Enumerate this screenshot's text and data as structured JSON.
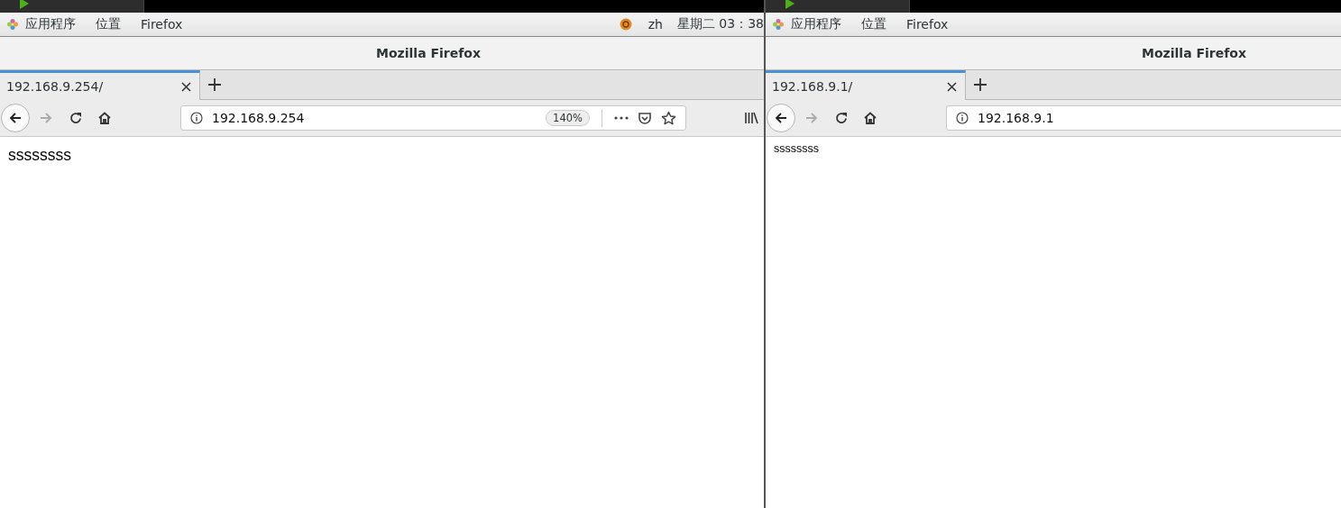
{
  "screens": [
    {
      "top_bar": {
        "menus": [
          "应用程序",
          "位置",
          "Firefox"
        ],
        "tray": {
          "language": "zh",
          "clock": "星期二 03：38"
        }
      },
      "window_title": "Mozilla Firefox",
      "tabs": [
        {
          "label": "192.168.9.254/",
          "selected": true
        }
      ],
      "address": {
        "value": "192.168.9.254",
        "zoom": "140%"
      },
      "show_library": true,
      "page_text": "ssssssss"
    },
    {
      "top_bar": {
        "menus": [
          "应用程序",
          "位置",
          "Firefox"
        ]
      },
      "window_title": "Mozilla Firefox",
      "tabs": [
        {
          "label": "192.168.9.1/",
          "selected": true
        }
      ],
      "address": {
        "value": "192.168.9.1"
      },
      "show_library": false,
      "page_text": "ssssssss"
    }
  ]
}
